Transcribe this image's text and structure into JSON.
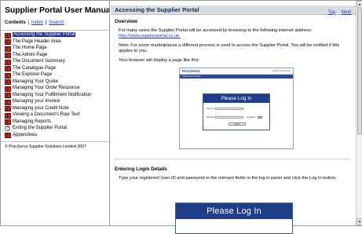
{
  "left": {
    "title": "Supplier Portal User Manual",
    "nav": {
      "contents_label": "Contents",
      "index_label": "Index",
      "search_label": "Search",
      "sep": "|"
    },
    "toc": [
      {
        "label": "Accessing the Supplier Portal",
        "icon": "book-icon",
        "active": true
      },
      {
        "label": "The Page Header Area",
        "icon": "book-icon"
      },
      {
        "label": "The Home Page",
        "icon": "book-icon"
      },
      {
        "label": "The Admin Page",
        "icon": "book-icon"
      },
      {
        "label": "The Document Summary",
        "icon": "book-icon"
      },
      {
        "label": "The Catalogue Page",
        "icon": "book-icon"
      },
      {
        "label": "The Explorer Page",
        "icon": "book-icon"
      },
      {
        "label": "Managing Your Quote",
        "icon": "book-icon"
      },
      {
        "label": "Managing Your Order Response",
        "icon": "book-icon"
      },
      {
        "label": "Managing Your Fulfillment Notification",
        "icon": "book-icon"
      },
      {
        "label": "Managing your Invoice",
        "icon": "book-icon"
      },
      {
        "label": "Managing your Credit Note",
        "icon": "book-icon"
      },
      {
        "label": "Viewing a Document's Raw Text",
        "icon": "book-icon"
      },
      {
        "label": "Managing Reports",
        "icon": "book-icon"
      },
      {
        "label": "Exiting the Supplier Portal",
        "icon": "help-topic-icon"
      },
      {
        "label": "Appendixes",
        "icon": "book-icon"
      }
    ],
    "copyright": "© ProcServe Supplier Solutions Limited 2007"
  },
  "right": {
    "section_title": "Accessing the Supplier Portal",
    "top_link": "Top",
    "next_link": "Next",
    "overview_heading": "Overview",
    "para1": "For many users the Supplier Portal will be accessed by browsing to the following internet address:",
    "para1_link": "http://www.supplierportal.co.uk.",
    "para2": "Note: For some marketplaces a different process is used to access the Supplier Portal. You will be notified if this applies to you.",
    "para3": "Your browser will display a page like this:",
    "screenshot": {
      "logo": "ProcServe",
      "header_links": "Help & Information",
      "band_text": "SUPPLIER PORTAL",
      "panel_title": "Please Log In",
      "user_label": "User ID:",
      "password_label": "Password:",
      "forgot_label": "Forgotten?",
      "go_label": "Go",
      "login_button": "Log In"
    },
    "login_heading": "Entering Login Details",
    "para4": "Type your registered User ID and password in the relevant fields in the log in panel and click the Log In button.",
    "big_panel_title": "Please Log In"
  },
  "scrollbar": {
    "up_glyph": "▲",
    "down_glyph": "▼"
  }
}
